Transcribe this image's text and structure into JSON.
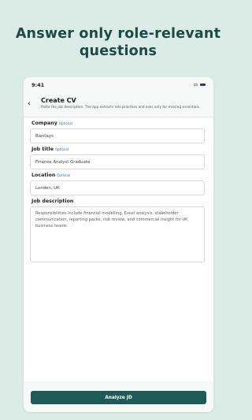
{
  "headline": {
    "line1": "Answer only role-relevant",
    "line2": "questions"
  },
  "status_bar": {
    "time": "9:41",
    "icons": [
      "wifi-icon",
      "battery-icon"
    ]
  },
  "header": {
    "back_icon": "chevron-left-icon",
    "title": "Create CV",
    "subtitle": "Paste the job description. The app extracts role priorities and asks only for missing essentials."
  },
  "form": {
    "company": {
      "label": "Company",
      "optional": "Optional",
      "value": "Barclays"
    },
    "job_title": {
      "label": "Job title",
      "optional": "Optional",
      "value": "Finance Analyst Graduate"
    },
    "location": {
      "label": "Location",
      "optional": "Optional",
      "value": "London, UK"
    },
    "job_description": {
      "label": "Job description",
      "value": "Responsibilities include financial modelling, Excel analysis, stakeholder communication, reporting packs, risk review, and commercial insight for UK business teams."
    }
  },
  "actions": {
    "analyze_label": "Analyze JD"
  },
  "colors": {
    "background": "#dbece6",
    "headline": "#1d4a47",
    "primary_button": "#1e5b58",
    "optional_tag": "#3f6aa8"
  }
}
